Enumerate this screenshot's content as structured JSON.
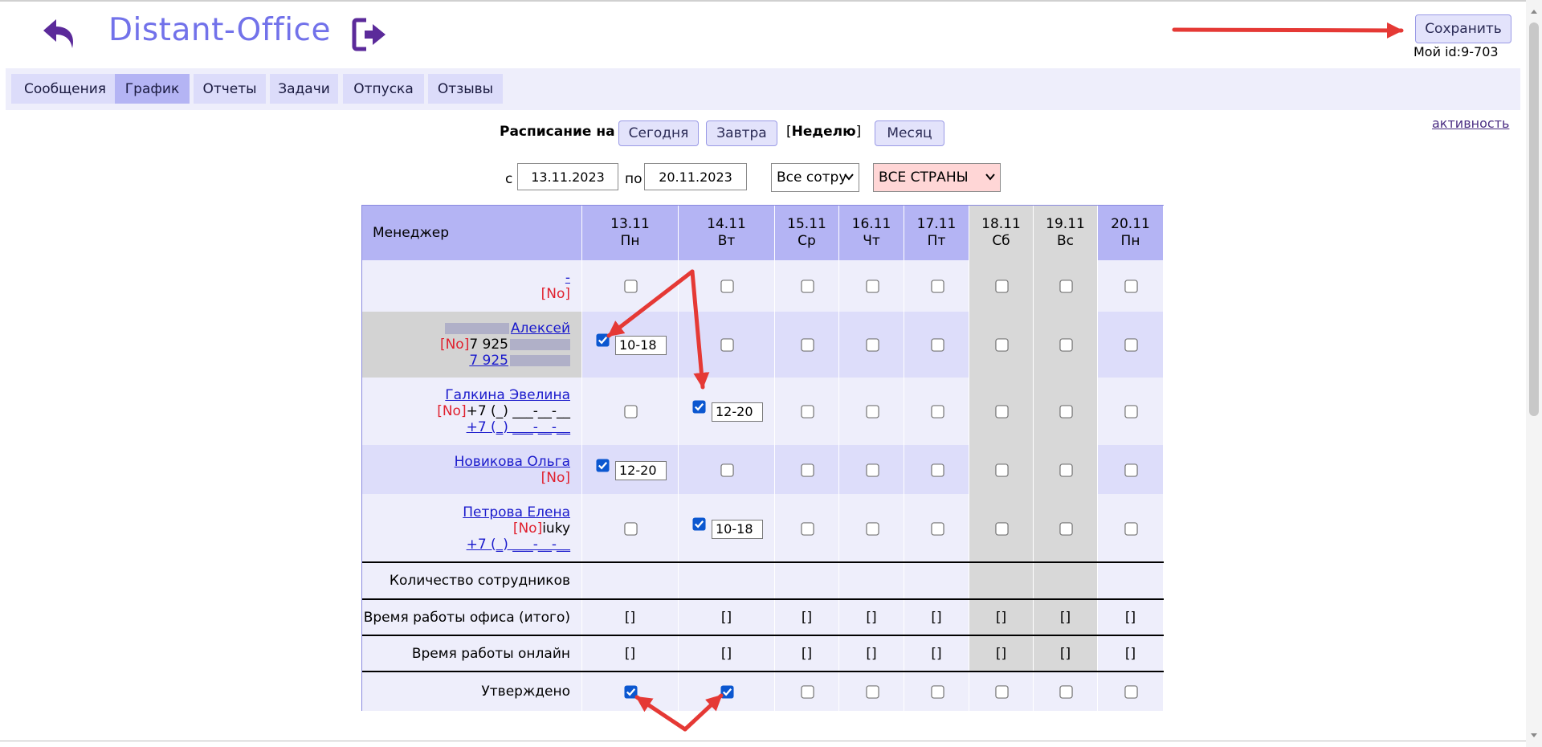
{
  "header": {
    "title": "Distant-Office",
    "save_label": "Сохранить",
    "my_id": "Мой id:9-703"
  },
  "nav": {
    "tabs": [
      {
        "label": "Сообщения",
        "active": false
      },
      {
        "label": "График",
        "active": true
      },
      {
        "label": "Отчеты",
        "active": false
      },
      {
        "label": "Задачи",
        "active": false
      },
      {
        "label": "Отпуска",
        "active": false
      },
      {
        "label": "Отзывы",
        "active": false
      }
    ]
  },
  "activity_link": "активность",
  "schedule": {
    "label": "Расписание на",
    "today_label": "Сегодня",
    "tomorrow_label": "Завтра",
    "week_open": "[",
    "week_label": "Неделю",
    "week_close": "]",
    "month_label": "Месяц"
  },
  "filters": {
    "from_label": "с",
    "from_value": "13.11.2023",
    "to_label": "по",
    "to_value": "20.11.2023",
    "staff_select": "Все сотру",
    "country_select": "ВСЕ СТРАНЫ"
  },
  "colors": {
    "header_bg": "#b4b4f4",
    "weekend_bg": "#d8d8d8",
    "row_light": "#eeeefb",
    "row_alt": "#ddddfa",
    "status_red": "#e0202e",
    "link_blue": "#1a1acc",
    "accent": "#7272ea",
    "annotation_arrow": "#e53935"
  },
  "table": {
    "manager_header": "Менеджер",
    "days": [
      {
        "date": "13.11",
        "dow": "Пн",
        "weekend": false
      },
      {
        "date": "14.11",
        "dow": "Вт",
        "weekend": false
      },
      {
        "date": "15.11",
        "dow": "Ср",
        "weekend": false
      },
      {
        "date": "16.11",
        "dow": "Чт",
        "weekend": false
      },
      {
        "date": "17.11",
        "dow": "Пт",
        "weekend": false
      },
      {
        "date": "18.11",
        "dow": "Сб",
        "weekend": true
      },
      {
        "date": "19.11",
        "dow": "Вс",
        "weekend": true
      },
      {
        "date": "20.11",
        "dow": "Пн",
        "weekend": false
      }
    ],
    "rows": [
      {
        "kind": "light",
        "lines": [
          {
            "text": "-",
            "style": "link"
          },
          {
            "parts": [
              {
                "text": "[No]",
                "style": "red"
              }
            ]
          }
        ],
        "cells": [
          {
            "checked": false
          },
          {
            "checked": false
          },
          {
            "checked": false
          },
          {
            "checked": false
          },
          {
            "checked": false
          },
          {
            "checked": false
          },
          {
            "checked": false
          },
          {
            "checked": false
          }
        ]
      },
      {
        "kind": "highlight",
        "lines": [
          {
            "text": "Алексей",
            "style": "link",
            "redacted_before": true
          },
          {
            "parts": [
              {
                "text": "[No]",
                "style": "red"
              },
              {
                "text": " 7 925",
                "style": "plain"
              }
            ],
            "redacted_after": true
          },
          {
            "text": "7 925",
            "style": "link",
            "redacted_after": true
          }
        ],
        "cells": [
          {
            "checked": true,
            "time": "10-18"
          },
          {
            "checked": false
          },
          {
            "checked": false
          },
          {
            "checked": false
          },
          {
            "checked": false
          },
          {
            "checked": false
          },
          {
            "checked": false
          },
          {
            "checked": false
          }
        ]
      },
      {
        "kind": "light",
        "lines": [
          {
            "text": "Галкина Эвелина",
            "style": "link"
          },
          {
            "parts": [
              {
                "text": "[No]",
                "style": "red"
              },
              {
                "text": " +7 (_) ___-__-__",
                "style": "plain"
              }
            ]
          },
          {
            "text": "+7 (_) ___-__-__",
            "style": "link"
          }
        ],
        "cells": [
          {
            "checked": false
          },
          {
            "checked": true,
            "time": "12-20"
          },
          {
            "checked": false
          },
          {
            "checked": false
          },
          {
            "checked": false
          },
          {
            "checked": false
          },
          {
            "checked": false
          },
          {
            "checked": false
          }
        ]
      },
      {
        "kind": "alt",
        "lines": [
          {
            "text": "Новикова Ольга",
            "style": "link"
          },
          {
            "parts": [
              {
                "text": "[No]",
                "style": "red"
              }
            ]
          }
        ],
        "cells": [
          {
            "checked": true,
            "time": "12-20"
          },
          {
            "checked": false
          },
          {
            "checked": false
          },
          {
            "checked": false
          },
          {
            "checked": false
          },
          {
            "checked": false
          },
          {
            "checked": false
          },
          {
            "checked": false
          }
        ]
      },
      {
        "kind": "light",
        "lines": [
          {
            "text": "Петрова Елена",
            "style": "link"
          },
          {
            "parts": [
              {
                "text": "[No]",
                "style": "red"
              },
              {
                "text": " iuky",
                "style": "plain"
              }
            ]
          },
          {
            "text": "+7 (_) ___-__-__",
            "style": "link"
          }
        ],
        "cells": [
          {
            "checked": false
          },
          {
            "checked": true,
            "time": "10-18"
          },
          {
            "checked": false
          },
          {
            "checked": false
          },
          {
            "checked": false
          },
          {
            "checked": false
          },
          {
            "checked": false
          },
          {
            "checked": false
          }
        ]
      }
    ],
    "summary": {
      "count_label": "Количество сотрудников",
      "office_label": "Время работы офиса (итого)",
      "online_label": "Время работы онлайн",
      "approved_label": "Утверждено",
      "empty_value": "[]",
      "approved": [
        true,
        true,
        false,
        false,
        false,
        false,
        false,
        false
      ]
    }
  }
}
